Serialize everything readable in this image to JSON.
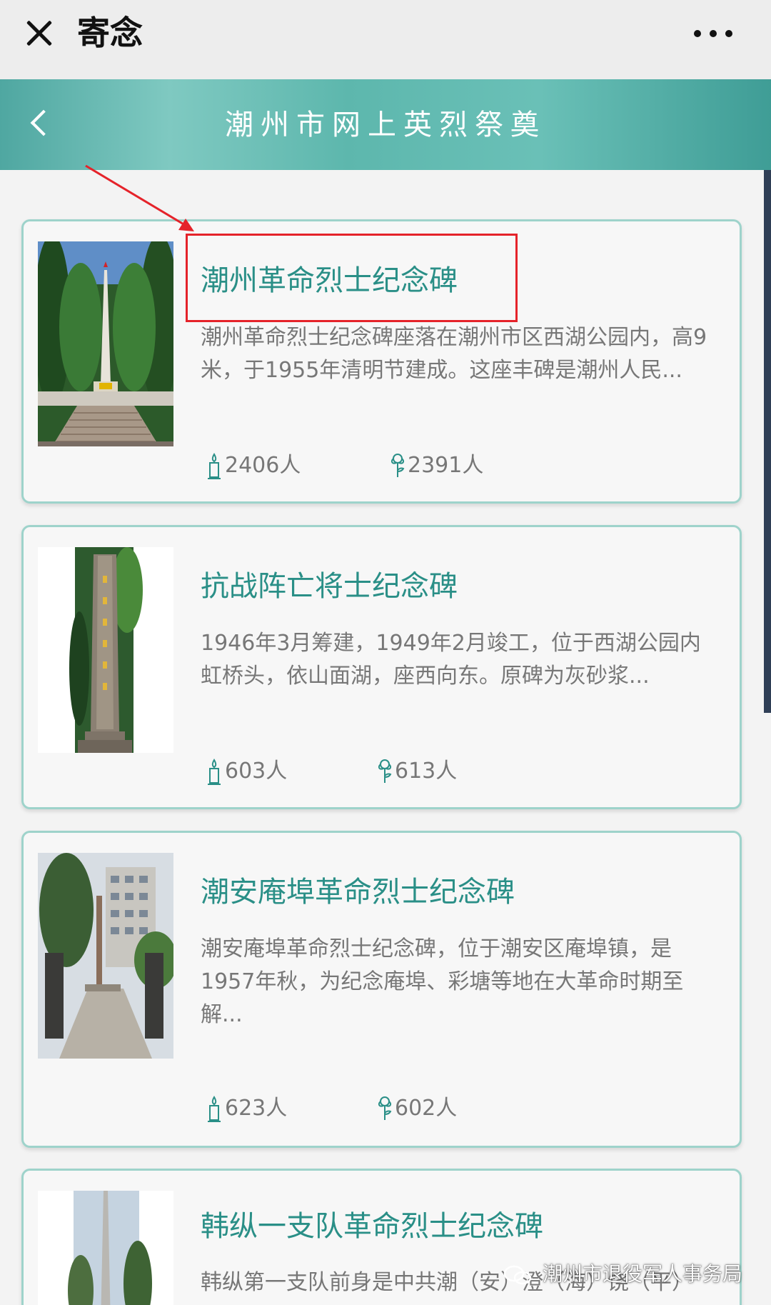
{
  "topbar": {
    "title": "寄念"
  },
  "header": {
    "title": "潮州市网上英烈祭奠"
  },
  "icons": {
    "close": "close-icon",
    "more": "more-icon",
    "back": "chevron-left-icon",
    "candle": "candle-icon",
    "flower": "flower-icon"
  },
  "colors": {
    "accent": "#2a8f87",
    "header_teal": "#5db7ad",
    "card_border": "#9ed3cb",
    "annotation": "#e5232a"
  },
  "memorials": [
    {
      "title": "潮州革命烈士纪念碑",
      "description": "潮州革命烈士纪念碑座落在潮州市区西湖公园内，高9米，于1955年清明节建成。这座丰碑是潮州人民...",
      "candles": "2406人",
      "flowers": "2391人"
    },
    {
      "title": "抗战阵亡将士纪念碑",
      "description": "1946年3月筹建，1949年2月竣工，位于西湖公园内虹桥头，依山面湖，座西向东。原碑为灰砂浆...",
      "candles": "603人",
      "flowers": "613人"
    },
    {
      "title": "潮安庵埠革命烈士纪念碑",
      "description": "潮安庵埠革命烈士纪念碑，位于潮安区庵埠镇，是1957年秋，为纪念庵埠、彩塘等地在大革命时期至解...",
      "candles": "623人",
      "flowers": "602人"
    },
    {
      "title": "韩纵一支队革命烈士纪念碑",
      "description": "韩纵第一支队前身是中共潮（安）澄（海）饶（平）"
    }
  ],
  "watermark": {
    "text": "潮州市退役军人事务局"
  }
}
